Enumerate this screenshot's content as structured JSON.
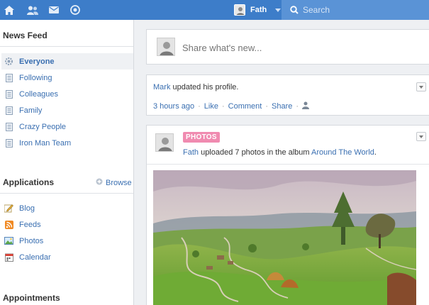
{
  "topbar": {
    "icons": [
      "home-icon",
      "people-icon",
      "mail-icon",
      "activity-icon"
    ],
    "user_name": "Fath",
    "search_placeholder": "Search"
  },
  "sidebar": {
    "news_feed_title": "News Feed",
    "feeds": [
      {
        "label": "Everyone",
        "icon": "gear-icon",
        "active": true
      },
      {
        "label": "Following",
        "icon": "document-icon"
      },
      {
        "label": "Colleagues",
        "icon": "document-icon"
      },
      {
        "label": "Family",
        "icon": "document-icon"
      },
      {
        "label": "Crazy People",
        "icon": "document-icon"
      },
      {
        "label": "Iron Man Team",
        "icon": "document-icon"
      }
    ],
    "applications_title": "Applications",
    "browse_label": "Browse",
    "apps": [
      {
        "label": "Blog",
        "icon": "pencil-icon"
      },
      {
        "label": "Feeds",
        "icon": "rss-icon"
      },
      {
        "label": "Photos",
        "icon": "photo-icon"
      },
      {
        "label": "Calendar",
        "icon": "calendar-icon"
      }
    ],
    "appointments_title": "Appointments"
  },
  "composer": {
    "placeholder": "Share what's new..."
  },
  "post1": {
    "author": "Mark",
    "action": " updated his profile.",
    "time": "3 hours ago",
    "like": "Like",
    "comment": "Comment",
    "share": "Share"
  },
  "post2": {
    "badge": "PHOTOS",
    "author": "Fath",
    "action": " uploaded 7 photos in the album ",
    "album": "Around The World",
    "end": "."
  }
}
